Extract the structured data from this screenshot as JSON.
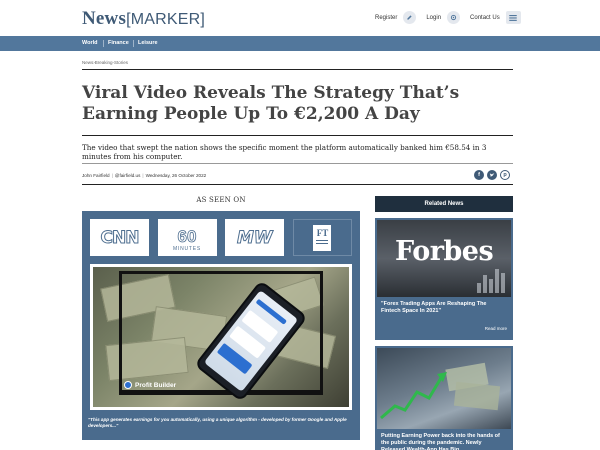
{
  "header": {
    "logo_news": "News",
    "logo_marker": "[MARKER]",
    "links": [
      "Register",
      "Login",
      "Contact Us"
    ]
  },
  "nav": {
    "items": [
      "World",
      "Finance",
      "Leisure"
    ]
  },
  "breadcrumb": "News›Breaking-Stories",
  "article": {
    "headline": "Viral Video Reveals The Strategy That’s Earning People Up To €2,200 A Day",
    "subhead": "The video that swept the nation shows the specific moment the platform automatically banked him €58.54 in 3 minutes from his computer.",
    "author": "John Fairfield",
    "handle": "@fairfield.us",
    "date": "Wednesday, 26 October 2022"
  },
  "as_seen_on": {
    "label": "AS SEEN ON",
    "logos": [
      "CNN",
      "60 MINUTES",
      "MW",
      "FT"
    ]
  },
  "video": {
    "brand": "Profit Builder"
  },
  "caption": "\"This app generates earnings for you automatically, using a unique algorithm - developed by former Google and Apple developers...\"",
  "sidebar": {
    "heading": "Related News",
    "cards": [
      {
        "image_text": "Forbes",
        "title": "\"Forex Trading Apps Are Reshaping The Fintech Space In 2021\"",
        "more": "Read more"
      },
      {
        "title": "Putting Earning Power back into the hands of the public during the pandemic. Newly Released Wealth-App Has Big"
      }
    ]
  },
  "colors": {
    "brand_blue": "#52779c",
    "panel_blue": "#4a6b8d",
    "dark_header": "#1f2f3e"
  }
}
